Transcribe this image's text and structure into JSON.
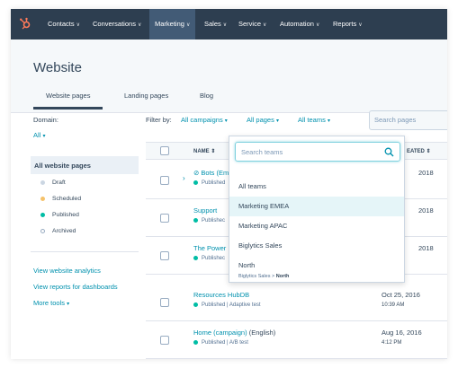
{
  "nav": {
    "items": [
      "Contacts",
      "Conversations",
      "Marketing",
      "Sales",
      "Service",
      "Automation",
      "Reports"
    ]
  },
  "page": {
    "title": "Website",
    "tabs": [
      "Website pages",
      "Landing pages",
      "Blog"
    ]
  },
  "sidebar": {
    "domain_label": "Domain:",
    "domain_value": "All",
    "all_pages": "All website pages",
    "statuses": [
      {
        "label": "Draft",
        "color": "#cbd6e2"
      },
      {
        "label": "Scheduled",
        "color": "#f5c26b"
      },
      {
        "label": "Published",
        "color": "#00bda5"
      },
      {
        "label": "Archived",
        "color": "#ffffff"
      }
    ],
    "links": [
      "View website analytics",
      "View reports for dashboards",
      "More tools"
    ]
  },
  "filters": {
    "label": "Filter by:",
    "campaigns": "All campaigns",
    "pages": "All pages",
    "teams": "All teams",
    "search_placeholder": "Search pages"
  },
  "table": {
    "col_name": "NAME",
    "col_created": "EATED",
    "rows": [
      {
        "name": "Bots (Em",
        "status": "Published",
        "date": "2018",
        "time": ""
      },
      {
        "name": "Support",
        "status": "Publishec",
        "date": "2018",
        "time": ""
      },
      {
        "name": "The Power",
        "status": "Publishec",
        "date": "2018",
        "time": ""
      },
      {
        "name": "Resources HubDB",
        "status": "Published | Adaptive test",
        "date": "Oct 25, 2016",
        "time": "10:39 AM"
      },
      {
        "name": "Home (campaign)",
        "name_suffix": "(English)",
        "status": "Published | A/B test",
        "date": "Aug 16, 2016",
        "time": "4:12 PM"
      }
    ]
  },
  "dropdown": {
    "search_placeholder": "Search teams",
    "items": [
      "All teams",
      "Marketing EMEA",
      "Marketing APAC",
      "Biglytics Sales",
      "North"
    ],
    "crumb_parent": "Biglytics Sales >",
    "crumb_current": "North"
  },
  "colors": {
    "nav_bg": "#2d3e50",
    "accent": "#0091ae",
    "logo": "#ff7a59",
    "published": "#00bda5"
  }
}
